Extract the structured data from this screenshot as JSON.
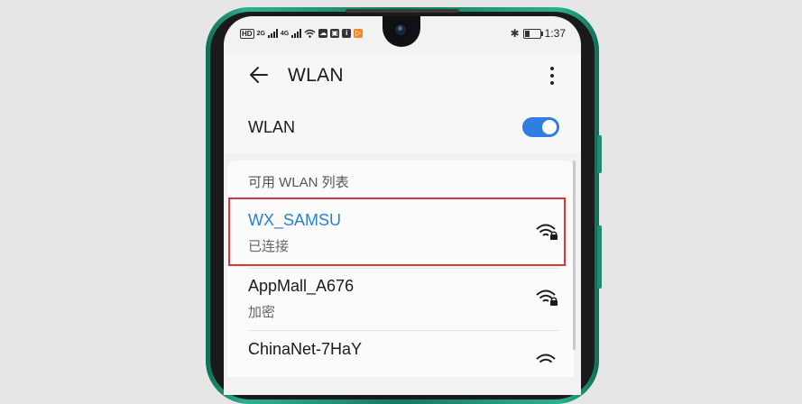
{
  "status_bar": {
    "left": {
      "hd_badge": "HD",
      "signal_1_tag": "2G",
      "signal_2_tag": "4G"
    },
    "time": "1:37"
  },
  "app_bar": {
    "back_icon": "back-arrow-icon",
    "title": "WLAN",
    "menu_icon": "more-vertical-icon"
  },
  "wlan_toggle": {
    "label": "WLAN",
    "enabled": true
  },
  "networks_section": {
    "header": "可用 WLAN 列表",
    "items": [
      {
        "name": "WX_SAMSU",
        "status": "已连接",
        "connected": true,
        "secured": true,
        "icon": "wifi-lock-icon"
      },
      {
        "name": "AppMall_A676",
        "status": "加密",
        "connected": false,
        "secured": true,
        "icon": "wifi-lock-icon"
      },
      {
        "name": "ChinaNet-7HaY",
        "status": "",
        "connected": false,
        "secured": true,
        "icon": "wifi-lock-icon"
      }
    ]
  },
  "colors": {
    "accent": "#2f7ee0",
    "connected_text": "#2a7fd4",
    "highlight_border": "#d8363b",
    "phone_frame": "#1f8c6f"
  }
}
